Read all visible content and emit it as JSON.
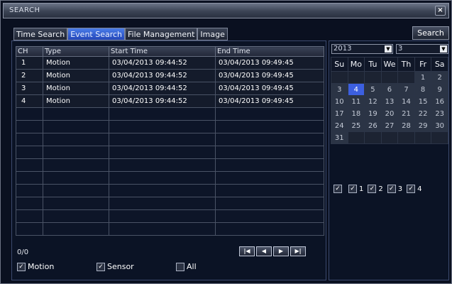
{
  "window": {
    "title": "SEARCH",
    "close_label": "×"
  },
  "tabs": [
    {
      "label": "Time Search",
      "active": false
    },
    {
      "label": "Event Search",
      "active": true
    },
    {
      "label": "File Management",
      "active": false
    },
    {
      "label": "Image",
      "active": false
    }
  ],
  "search_button": "Search",
  "table": {
    "columns": [
      "CH",
      "Type",
      "Start Time",
      "End Time"
    ],
    "rows": [
      {
        "ch": "1",
        "type": "Motion",
        "start": "03/04/2013 09:44:52",
        "end": "03/04/2013 09:49:45"
      },
      {
        "ch": "2",
        "type": "Motion",
        "start": "03/04/2013 09:44:52",
        "end": "03/04/2013 09:49:45"
      },
      {
        "ch": "3",
        "type": "Motion",
        "start": "03/04/2013 09:44:52",
        "end": "03/04/2013 09:49:45"
      },
      {
        "ch": "4",
        "type": "Motion",
        "start": "03/04/2013 09:44:52",
        "end": "03/04/2013 09:49:45"
      }
    ]
  },
  "pager": {
    "count": "0/0",
    "first": "|◀",
    "prev": "◀",
    "next": "▶",
    "last": "▶|"
  },
  "filters": {
    "motion": {
      "label": "Motion",
      "checked": true
    },
    "sensor": {
      "label": "Sensor",
      "checked": true
    },
    "all": {
      "label": "All",
      "checked": false
    }
  },
  "calendar": {
    "year": "2013",
    "month": "3",
    "weekdays": [
      "Su",
      "Mo",
      "Tu",
      "We",
      "Th",
      "Fr",
      "Sa"
    ],
    "weeks": [
      [
        "",
        "",
        "",
        "",
        "",
        "1",
        "2"
      ],
      [
        "3",
        "4",
        "5",
        "6",
        "7",
        "8",
        "9"
      ],
      [
        "10",
        "11",
        "12",
        "13",
        "14",
        "15",
        "16"
      ],
      [
        "17",
        "18",
        "19",
        "20",
        "21",
        "22",
        "23"
      ],
      [
        "24",
        "25",
        "26",
        "27",
        "28",
        "29",
        "30"
      ],
      [
        "31",
        "",
        "",
        "",
        "",
        "",
        ""
      ]
    ],
    "selected_day": "4"
  },
  "channels": [
    {
      "label": "",
      "checked": true
    },
    {
      "label": "1",
      "checked": true
    },
    {
      "label": "2",
      "checked": true
    },
    {
      "label": "3",
      "checked": true
    },
    {
      "label": "4",
      "checked": true
    }
  ],
  "colors": {
    "accent": "#3c5fe0",
    "tab_active": "#2f5fd6",
    "background": "#0b1325"
  }
}
